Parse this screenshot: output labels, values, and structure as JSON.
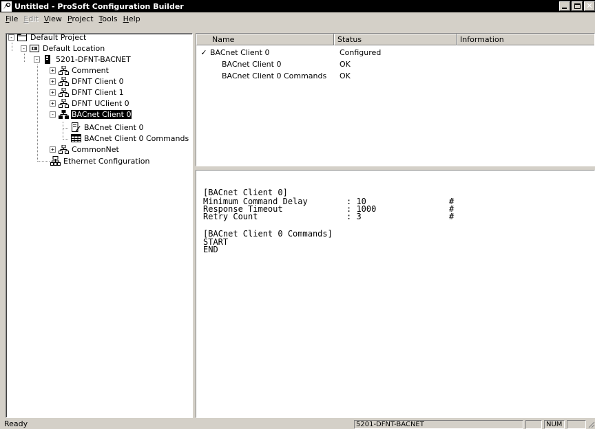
{
  "window": {
    "title": "Untitled - ProSoft Configuration Builder"
  },
  "menubar": {
    "items": [
      {
        "label": "File",
        "acc": "F",
        "rest": "ile",
        "disabled": false
      },
      {
        "label": "Edit",
        "acc": "E",
        "rest": "dit",
        "disabled": true
      },
      {
        "label": "View",
        "acc": "V",
        "rest": "iew",
        "disabled": false
      },
      {
        "label": "Project",
        "acc": "P",
        "rest": "roject",
        "disabled": false
      },
      {
        "label": "Tools",
        "acc": "T",
        "rest": "ools",
        "disabled": false
      },
      {
        "label": "Help",
        "acc": "H",
        "rest": "elp",
        "disabled": false
      }
    ]
  },
  "tree": {
    "items": [
      {
        "label": "Default Project",
        "icon": "project-folder-icon",
        "expander": "-",
        "selected": false
      },
      {
        "label": "Default Location",
        "icon": "location-icon",
        "expander": "-",
        "selected": false
      },
      {
        "label": "5201-DFNT-BACNET",
        "icon": "module-icon",
        "expander": "-",
        "selected": false
      },
      {
        "label": "Comment",
        "icon": "network-icon",
        "expander": "+",
        "selected": false
      },
      {
        "label": "DFNT Client 0",
        "icon": "network-icon",
        "expander": "+",
        "selected": false
      },
      {
        "label": "DFNT Client 1",
        "icon": "network-icon",
        "expander": "+",
        "selected": false
      },
      {
        "label": "DFNT UClient 0",
        "icon": "network-icon",
        "expander": "+",
        "selected": false
      },
      {
        "label": "BACnet Client 0",
        "icon": "network-icon",
        "expander": "-",
        "selected": true
      },
      {
        "label": "BACnet Client 0",
        "icon": "document-edit-icon",
        "expander": "",
        "selected": false
      },
      {
        "label": "BACnet Client 0 Commands",
        "icon": "table-grid-icon",
        "expander": "",
        "selected": false
      },
      {
        "label": "CommonNet",
        "icon": "network-icon",
        "expander": "+",
        "selected": false
      },
      {
        "label": "Ethernet Configuration",
        "icon": "ethernet-icon",
        "expander": "",
        "selected": false
      }
    ]
  },
  "list": {
    "columns": [
      "Name",
      "Status",
      "Information"
    ],
    "rows": [
      {
        "name": "BACnet Client 0",
        "status": "Configured",
        "checked": true
      },
      {
        "name": "BACnet Client 0",
        "status": "OK",
        "checked": false
      },
      {
        "name": "BACnet Client 0 Commands",
        "status": "OK",
        "checked": false
      }
    ]
  },
  "config": {
    "section1": "[BACnet Client 0]",
    "params": [
      {
        "key": "Minimum Command Delay",
        "value": ": 10",
        "comment": "#"
      },
      {
        "key": "Response Timeout",
        "value": ": 1000",
        "comment": "#"
      },
      {
        "key": "Retry Count",
        "value": ": 3",
        "comment": "#"
      }
    ],
    "section2": "[BACnet Client 0 Commands]",
    "start": "START",
    "end": "END"
  },
  "statusbar": {
    "ready": "Ready",
    "module": "5201-DFNT-BACNET",
    "num": "NUM"
  }
}
